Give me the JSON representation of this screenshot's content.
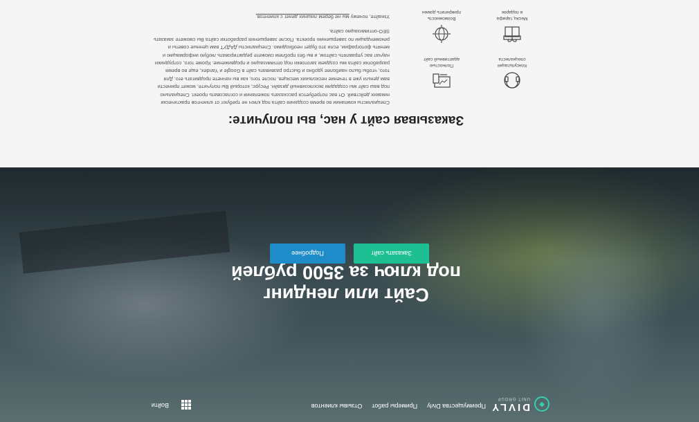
{
  "nav": {
    "logo_name": "DIVLY",
    "logo_sub": "UNIT GROUP",
    "items": [
      {
        "label": "Преимущества Divly"
      },
      {
        "label": "Примеры работ"
      },
      {
        "label": "Отзывы клиентов"
      }
    ],
    "apps_icon": "grid-icon",
    "login": "Войти"
  },
  "hero": {
    "title_line1": "Сайт или лендинг",
    "title_line2": "под ключ за 3500 рублей",
    "order_button": "Заказать сайт",
    "more_button": "Подробнее",
    "colors": {
      "order": "#1dbf93",
      "more": "#1e8cc8"
    }
  },
  "features": {
    "title": "Заказывая сайт у нас, вы получите:",
    "description": "Специалисты компании во время создания сайта под ключ не требуют от клиентов практически никаких действий. От вас потребуется рассказать пожелания и согласовать проект. Специально под ваш сайт мы создадим эксклюзивный дизайн. Ресурс, который Вы получите, может принести вам деньги уже в течение нескольких месяцев, после того, как вы начнете продвигать его. Для того, чтобы было наиболее удобно и быстро развивать сайт в Google и Yandex, еще во время разработки сайта мы создаем заготовки под оптимизацию и продвижение. Кроме того, сотрудники научат вас управлять сайтом, и вы без проблем сможете редактировать любую информацию и менять фотографии, если это будет необходимо. Специалисты ДАДУТ вам ценные советы и рекомендации по завершению проекта. После завершения разработки сайта Вы сможете заказать SEO-оптимизацию сайта.",
    "cta_prefix": "Узнайте, почему ",
    "cta_emph": "мы не берем лишних денег с клиентов.",
    "items": [
      {
        "icon": "headset-icon",
        "label_1": "Консультация",
        "label_2": "специалиста"
      },
      {
        "icon": "devices-icon",
        "label_1": "Полностью",
        "label_2": "адаптивный сайт"
      },
      {
        "icon": "gift-icon",
        "label_1": "Месяц тарифа",
        "label_2": "в подарок"
      },
      {
        "icon": "globe-icon",
        "label_1": "Возможность",
        "label_2": "прикрепить домен"
      }
    ]
  }
}
